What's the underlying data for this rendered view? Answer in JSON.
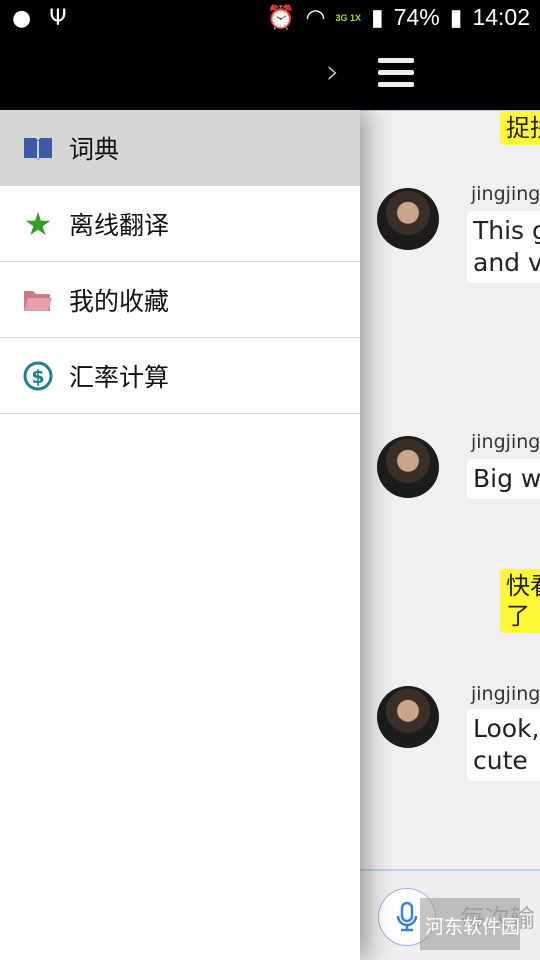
{
  "status_bar": {
    "network": "3G 1X",
    "battery": "74%",
    "time": "14:02",
    "icons": [
      "android-icon",
      "usb-icon",
      "alarm-icon",
      "wifi-icon",
      "signal-icon",
      "sim-icon",
      "battery-charging-icon"
    ]
  },
  "app_bar": {
    "icons": [
      "chevron-right-icon",
      "hamburger-menu-icon"
    ]
  },
  "drawer": {
    "items": [
      {
        "label": "词典",
        "icon": "book-icon",
        "selected": true
      },
      {
        "label": "离线翻译",
        "icon": "star-icon"
      },
      {
        "label": "我的收藏",
        "icon": "folder-icon"
      },
      {
        "label": "汇率计算",
        "icon": "dollar-icon"
      }
    ]
  },
  "chat": {
    "messages": [
      {
        "type": "outgoing",
        "text": "捉拼"
      },
      {
        "type": "incoming",
        "name": "jingjing",
        "text": [
          "This g",
          "and ve"
        ]
      },
      {
        "type": "incoming",
        "name": "jingjing",
        "text": [
          "Big w"
        ]
      },
      {
        "type": "outgoing",
        "text": [
          "快看",
          "了"
        ]
      },
      {
        "type": "incoming",
        "name": "jingjing",
        "text": [
          "Look,",
          "cute"
        ]
      }
    ],
    "input_placeholder": "每次输"
  },
  "watermark": "河东软件园",
  "colors": {
    "outgoing_bubble": "#fff83a",
    "accent": "#8fb3e2"
  }
}
